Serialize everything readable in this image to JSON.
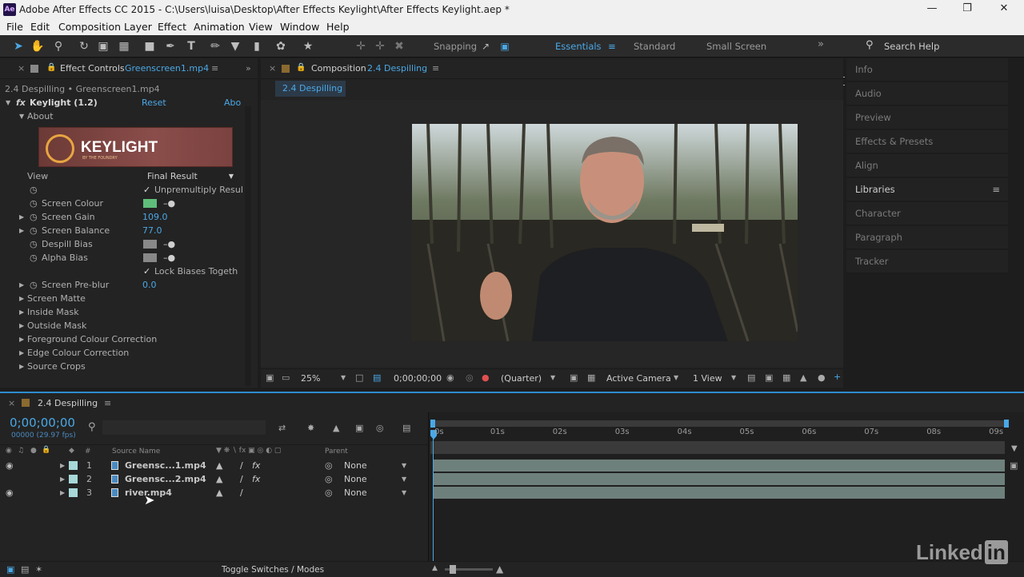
{
  "window": {
    "title": "Adobe After Effects CC 2015 - C:\\Users\\luisa\\Desktop\\After Effects Keylight\\After Effects Keylight.aep *",
    "app_icon": "Ae"
  },
  "menu": [
    "File",
    "Edit",
    "Composition",
    "Layer",
    "Effect",
    "Animation",
    "View",
    "Window",
    "Help"
  ],
  "toolbar": {
    "snapping": "Snapping",
    "workspaces": [
      "Essentials",
      "Standard",
      "Small Screen"
    ],
    "search_placeholder": "Search Help"
  },
  "effect_controls": {
    "tab_label": "Effect Controls",
    "tab_file": "Greenscreen1.mp4",
    "breadcrumb": "2.4 Despilling • Greenscreen1.mp4",
    "effect_name": "Keylight (1.2)",
    "reset": "Reset",
    "about_link": "Abo",
    "about": "About",
    "logo_text": "KEYLIGHT",
    "logo_sub": "BY THE FOUNDRY",
    "view_label": "View",
    "view_value": "Final Result",
    "unpremultiply": "Unpremultiply Resul",
    "screen_colour": "Screen Colour",
    "screen_colour_value": "#5fbf7a",
    "screen_gain": "Screen Gain",
    "screen_gain_value": "109.0",
    "screen_balance": "Screen Balance",
    "screen_balance_value": "77.0",
    "despill_bias": "Despill Bias",
    "alpha_bias": "Alpha Bias",
    "lock_biases": "Lock Biases Togeth",
    "screen_preblur": "Screen Pre-blur",
    "screen_preblur_value": "0.0",
    "groups": [
      "Screen Matte",
      "Inside Mask",
      "Outside Mask",
      "Foreground Colour Correction",
      "Edge Colour Correction",
      "Source Crops"
    ]
  },
  "composition": {
    "tab_label": "Composition",
    "tab_name": "2.4 Despilling",
    "sub_tab": "2.4 Despilling",
    "zoom": "25%",
    "timecode": "0;00;00;00",
    "resolution": "(Quarter)",
    "camera": "Active Camera",
    "views": "1 View"
  },
  "right_panels": [
    "Info",
    "Audio",
    "Preview",
    "Effects & Presets",
    "Align",
    "Libraries",
    "Character",
    "Paragraph",
    "Tracker"
  ],
  "timeline": {
    "tab_name": "2.4 Despilling",
    "timecode": "0;00;00;00",
    "fps": "00000 (29.97 fps)",
    "col_source": "Source Name",
    "col_parent": "Parent",
    "col_num": "#",
    "layers": [
      {
        "num": "1",
        "name": "Greensc...1.mp4",
        "parent": "None"
      },
      {
        "num": "2",
        "name": "Greensc...2.mp4",
        "parent": "None"
      },
      {
        "num": "3",
        "name": "river.mp4",
        "parent": "None"
      }
    ],
    "ruler": [
      "0s",
      "01s",
      "02s",
      "03s",
      "04s",
      "05s",
      "06s",
      "07s",
      "08s",
      "09s"
    ],
    "toggle": "Toggle Switches / Modes"
  },
  "watermark": "Linked"
}
